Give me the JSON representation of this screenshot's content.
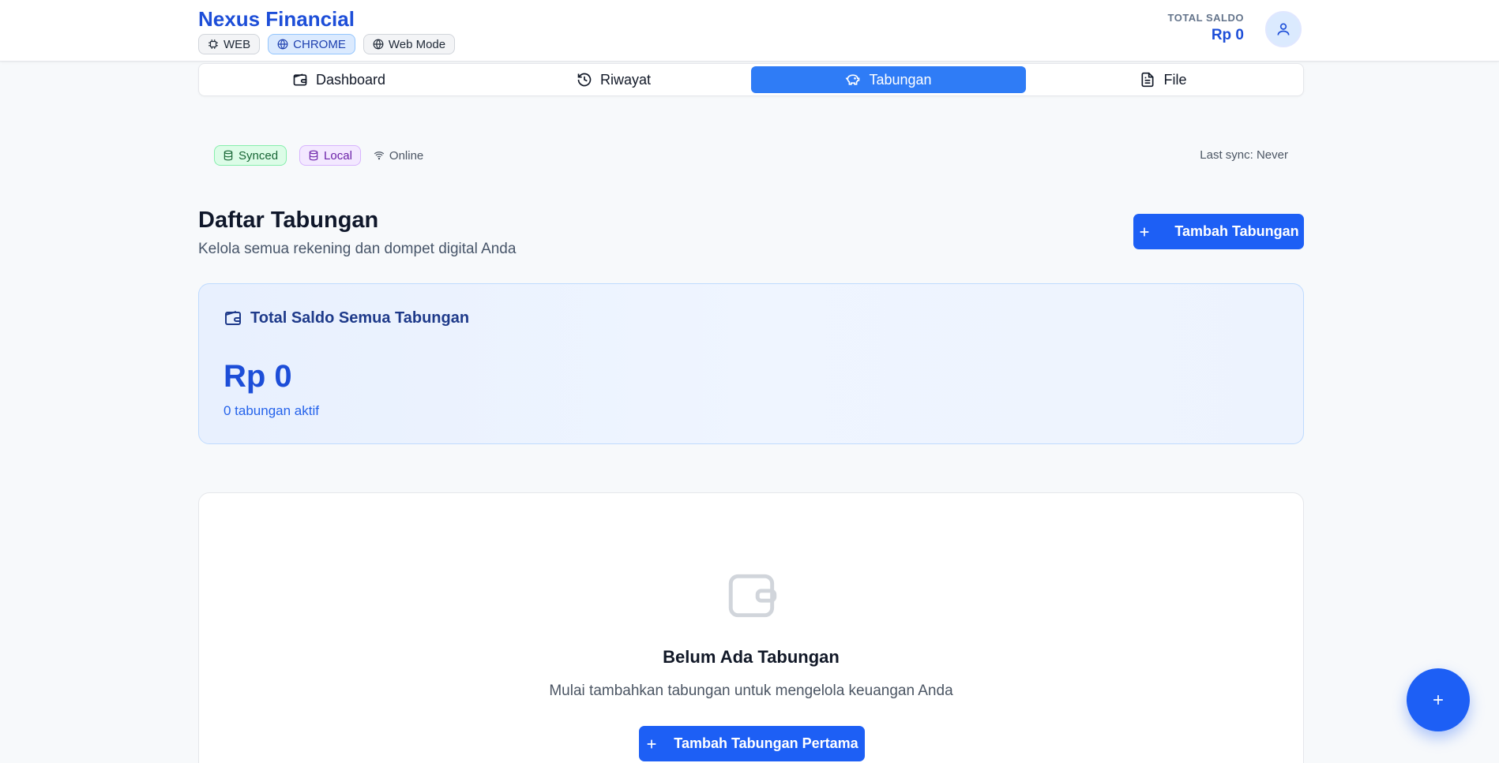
{
  "header": {
    "brand": "Nexus Financial",
    "pills": [
      {
        "label": "WEB",
        "icon": "cpu-icon"
      },
      {
        "label": "CHROME",
        "icon": "globe-icon"
      },
      {
        "label": "Web Mode",
        "icon": "globe-icon"
      }
    ],
    "saldo_label": "TOTAL SALDO",
    "saldo_value": "Rp 0"
  },
  "tabs": [
    {
      "label": "Dashboard",
      "icon": "wallet-icon"
    },
    {
      "label": "Riwayat",
      "icon": "history-icon"
    },
    {
      "label": "Tabungan",
      "icon": "piggy-bank-icon",
      "active": true
    },
    {
      "label": "File",
      "icon": "file-text-icon"
    }
  ],
  "status": {
    "synced": "Synced",
    "local": "Local",
    "online": "Online",
    "last_sync": "Last sync: Never"
  },
  "page": {
    "title": "Daftar Tabungan",
    "subtitle": "Kelola semua rekening dan dompet digital Anda",
    "add_button": "Tambah Tabungan"
  },
  "total_card": {
    "title": "Total Saldo Semua Tabungan",
    "amount": "Rp 0",
    "count": "0 tabungan aktif"
  },
  "empty_state": {
    "title": "Belum Ada Tabungan",
    "description": "Mulai tambahkan tabungan untuk mengelola keuangan Anda",
    "button": "Tambah Tabungan Pertama"
  },
  "colors": {
    "primary": "#1d5ff5",
    "brand": "#1d4ed8",
    "tab_active": "#2f7cf6"
  }
}
